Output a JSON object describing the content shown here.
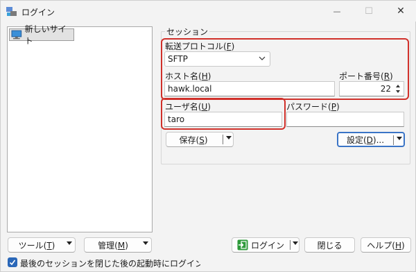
{
  "window": {
    "title": "ログイン",
    "controls": {
      "minimize": "—",
      "maximize": "☐",
      "close": "✕"
    }
  },
  "site_tree": {
    "items": [
      {
        "label": "新しいサイト"
      }
    ]
  },
  "session": {
    "group_label": "セッション",
    "protocol": {
      "label": "転送プロトコル",
      "mnemonic": "F",
      "value": "SFTP"
    },
    "host": {
      "label": "ホスト名",
      "mnemonic": "H",
      "value": "hawk.local"
    },
    "port": {
      "label": "ポート番号",
      "mnemonic": "R",
      "value": "22"
    },
    "user": {
      "label": "ユーザ名",
      "mnemonic": "U",
      "value": "taro"
    },
    "password": {
      "label": "パスワード",
      "mnemonic": "P",
      "value": ""
    },
    "save_button": {
      "label": "保存",
      "mnemonic": "S"
    },
    "settings_button": {
      "label": "設定",
      "mnemonic": "D",
      "suffix": "..."
    }
  },
  "bottom": {
    "tools_button": {
      "label": "ツール",
      "mnemonic": "T"
    },
    "manage_button": {
      "label": "管理",
      "mnemonic": "M"
    },
    "login_button": {
      "label": "ログイン"
    },
    "close_button": {
      "label": "閉じる"
    },
    "help_button": {
      "label": "ヘルプ",
      "mnemonic": "H"
    },
    "show_login_checkbox": {
      "checked": true,
      "label": "最後のセッションを閉じた後の起動時にログインを表示(S"
    }
  },
  "colors": {
    "highlight": "#d0302a",
    "accent": "#2a67b8",
    "login_icon": "#2e9a3a"
  }
}
